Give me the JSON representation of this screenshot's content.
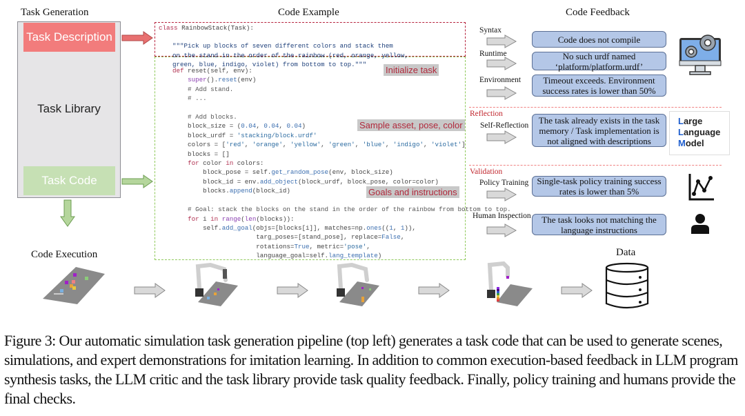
{
  "headers": {
    "task_generation": "Task Generation",
    "code_example": "Code Example",
    "code_feedback": "Code Feedback",
    "code_execution": "Code Execution",
    "data": "Data"
  },
  "task_library": {
    "description": "Task Description",
    "library": "Task Library",
    "code": "Task Code"
  },
  "code_example": {
    "class_line": {
      "kw": "class",
      "rest": " RainbowStack(Task):"
    },
    "docstring": [
      "\"\"\"Pick up blocks of seven different colors and stack them",
      "on the stand in the order of the rainbow (red, orange, yellow,",
      "green, blue, indigo, violet) from bottom to top.\"\"\""
    ],
    "lines": [
      "def reset(self, env):",
      "    super().reset(env)",
      "    # Add stand.",
      "    # ...",
      "",
      "    # Add blocks.",
      "    block_size = (0.04, 0.04, 0.04)",
      "    block_urdf = 'stacking/block.urdf'",
      "    colors = ['red', 'orange', 'yellow', 'green', 'blue', 'indigo', 'violet']",
      "    blocks = []",
      "    for color in colors:",
      "        block_pose = self.get_random_pose(env, block_size)",
      "        block_id = env.add_object(block_urdf, block_pose, color=color)",
      "        blocks.append(block_id)",
      "",
      "    # Goal: stack the blocks on the stand in the order of the rainbow from bottom to top.",
      "    for i in range(len(blocks)):",
      "        self.add_goal(objs=[blocks[i]], matches=np.ones((1, 1)),",
      "                      targ_poses=[stand_pose], replace=False,",
      "                      rotations=True, metric='pose',",
      "                      language_goal=self.lang_template)"
    ],
    "annotations": {
      "initialize": "Initialize task",
      "sample": "Sample asset, pose, color",
      "goals": "Goals and instructions"
    }
  },
  "feedback": {
    "execution": [
      {
        "label": "Syntax",
        "message": "Code does not compile"
      },
      {
        "label": "Runtime",
        "message": "No such urdf named ‘platform/platform.urdf’"
      },
      {
        "label": "Environment",
        "message": "Timeout exceeds. Environment success rates is lower than 50%"
      }
    ],
    "reflection": {
      "section": "Reflection",
      "label": "Self-Reflection",
      "message": "The task already exists in the task memory / Task implementation is not aligned with descriptions"
    },
    "validation": {
      "section": "Validation",
      "items": [
        {
          "label": "Policy Training",
          "message": "Single-task policy training success rates is lower than 5%"
        },
        {
          "label": "Human Inspection",
          "message": "The task looks not matching the language instructions"
        }
      ]
    },
    "llm": {
      "line1_cap": "L",
      "line1_rest": "arge",
      "line2_cap": "L",
      "line2_rest": "anguage",
      "line3_cap": "M",
      "line3_rest": "odel"
    }
  },
  "icons": {
    "computer": "computer-gears-icon",
    "chart": "line-chart-icon",
    "person": "person-icon",
    "database": "database-icon"
  },
  "colors": {
    "task_description": "#f27c7c",
    "task_code": "#c6e0b4",
    "feedback_box": "#b4c7e7",
    "section_red": "#c0262d"
  },
  "caption": "Figure 3: Our automatic simulation task generation pipeline (top left) generates a task code that can be used to generate scenes, simulations, and expert demonstrations for imitation learning. In addition to common execution-based feedback in LLM program synthesis tasks, the LLM critic and the task library provide task quality feedback. Finally, policy training and humans provide the final checks."
}
